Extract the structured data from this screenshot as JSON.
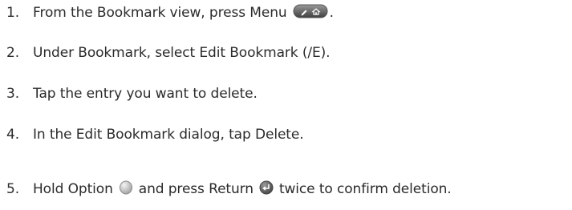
{
  "steps": [
    {
      "number": "1.",
      "text_before": "From the Bookmark view, press Menu",
      "icon": "menu-button-icon",
      "text_after": "."
    },
    {
      "number": "2.",
      "text": "Under Bookmark, select Edit Bookmark (/E)."
    },
    {
      "number": "3.",
      "text": "Tap the entry you want to delete."
    },
    {
      "number": "4.",
      "text": "In the Edit Bookmark dialog, tap Delete."
    },
    {
      "number": "5.",
      "text_part1": "Hold Option",
      "icon_option": "option-key-icon",
      "text_part2": "and press Return",
      "icon_return": "return-key-icon",
      "text_part3": "twice to confirm deletion."
    }
  ]
}
